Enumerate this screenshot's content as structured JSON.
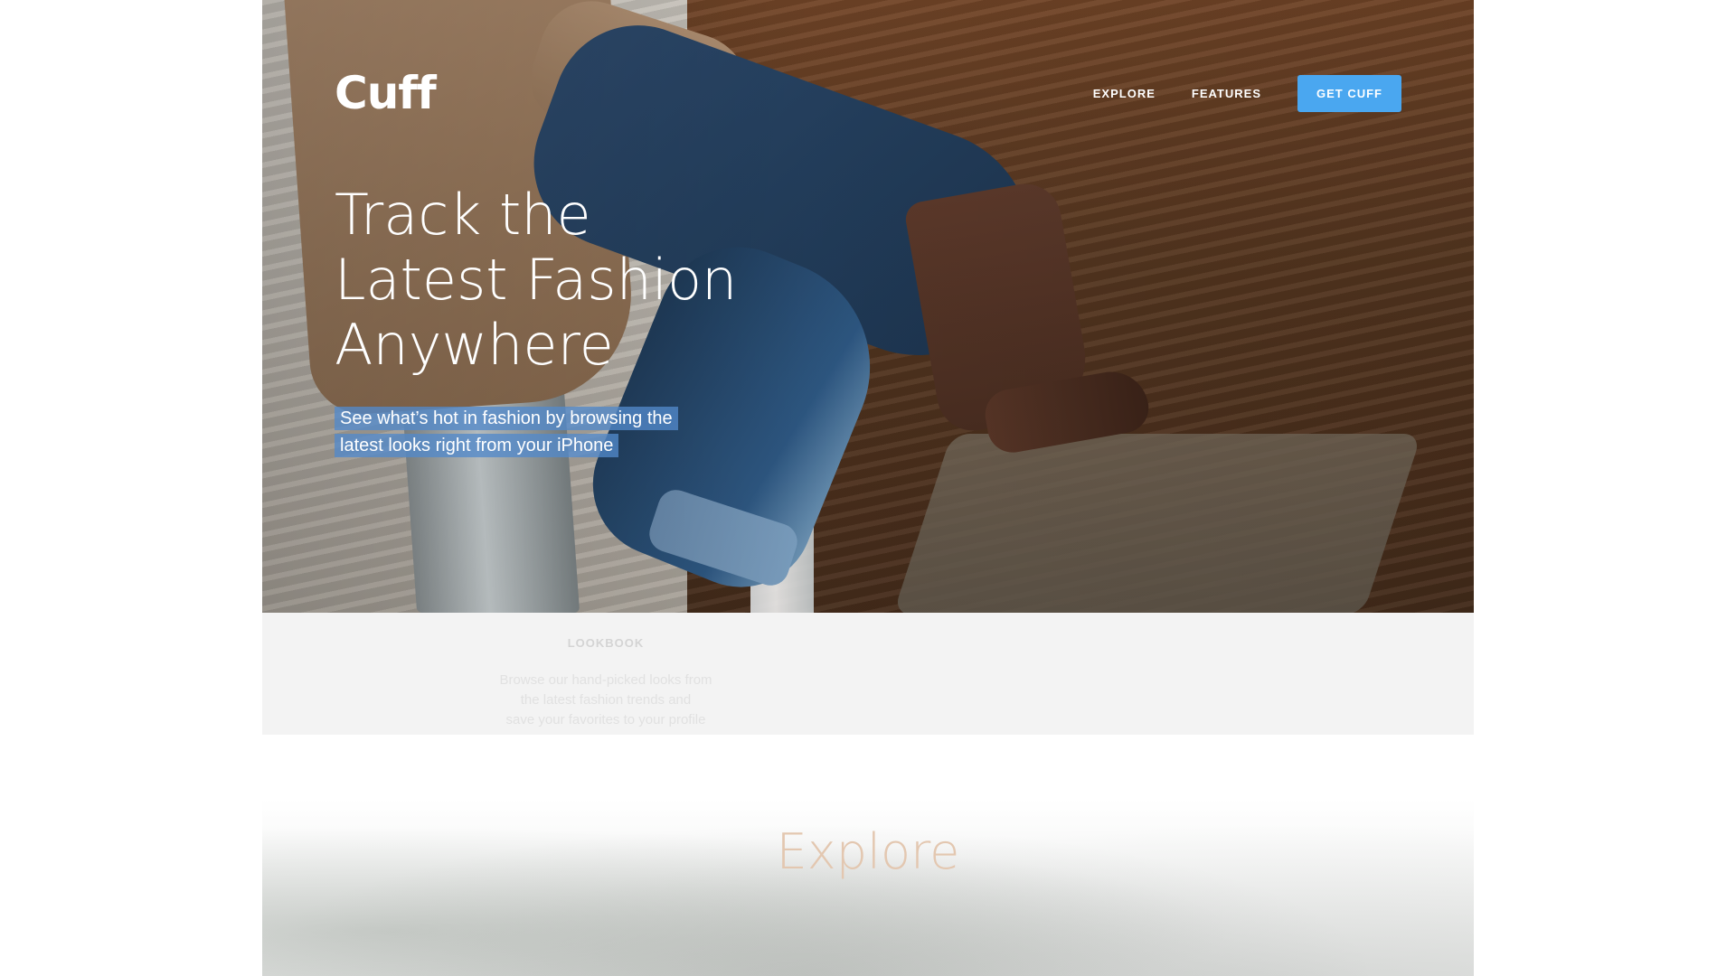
{
  "brand": {
    "name": "Cuff"
  },
  "nav": {
    "links": [
      {
        "label": "EXPLORE"
      },
      {
        "label": "FEATURES"
      }
    ],
    "cta": {
      "label": "GET CUFF",
      "color": "#4aa7f0"
    }
  },
  "hero": {
    "title_lines": [
      "Track the",
      "Latest Fashion",
      "Anywhere"
    ],
    "subtitle_lines": [
      "See what’s hot in fashion by browsing the",
      "latest looks right from your iPhone"
    ]
  },
  "lookbook": {
    "label": "LOOKBOOK",
    "description_lines": [
      "Browse our hand-picked looks from",
      "the latest fashion trends and",
      "save your favorites to your profile"
    ]
  },
  "explore": {
    "title": "Explore"
  }
}
